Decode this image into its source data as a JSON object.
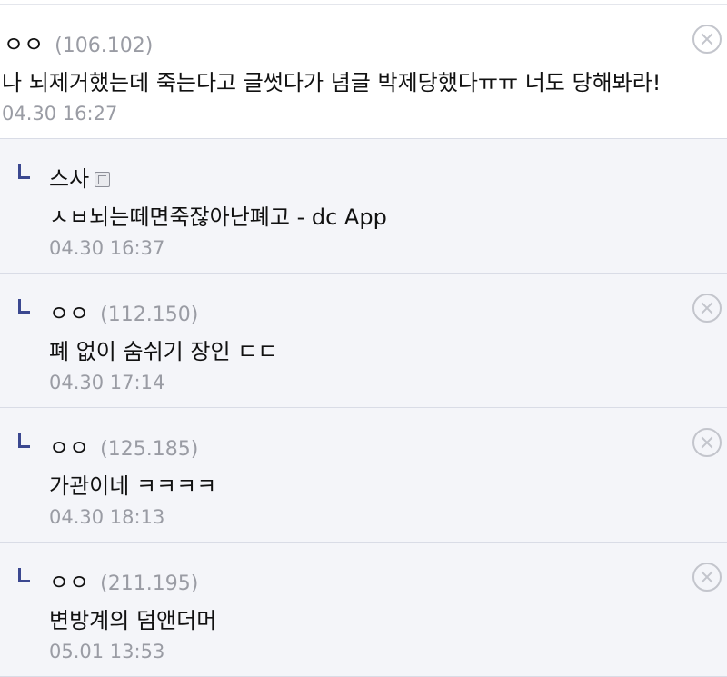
{
  "comments": [
    {
      "nickname": "ㅇㅇ",
      "ip": "(106.102)",
      "text": "나 뇌제거했는데 죽는다고 글썻다가 념글 박제당했다ㅠㅠ 너도 당해봐라!",
      "date": "04.30 16:27"
    },
    {
      "nickname": "스사",
      "ip": "",
      "text": "ㅅㅂ뇌는떼면죽잖아난폐고 - dc App",
      "date": "04.30 16:37",
      "fixed_nick_icon": "fixed-nick-icon"
    },
    {
      "nickname": "ㅇㅇ",
      "ip": "(112.150)",
      "text": "폐 없이 숨쉬기 장인 ㄷㄷ",
      "date": "04.30 17:14"
    },
    {
      "nickname": "ㅇㅇ",
      "ip": "(125.185)",
      "text": "가관이네 ㅋㅋㅋㅋ",
      "date": "04.30 18:13"
    },
    {
      "nickname": "ㅇㅇ",
      "ip": "(211.195)",
      "text": "변방계의 덤앤더머",
      "date": "05.01 13:53"
    }
  ],
  "icons": {
    "delete": "close-circle-icon",
    "reply": "reply-arrow-icon"
  },
  "colors": {
    "reply_bg": "#f4f5f9",
    "reply_mark": "#3b4890",
    "meta_text": "#9a9ca4"
  }
}
